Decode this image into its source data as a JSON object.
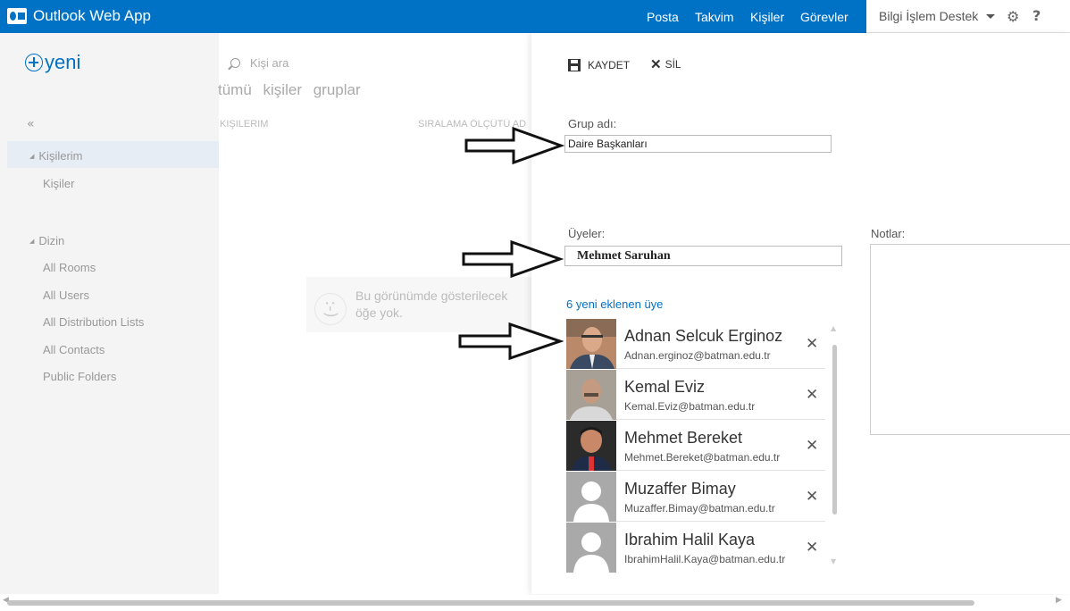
{
  "topbar": {
    "app_title": "Outlook Web App",
    "nav": [
      "Posta",
      "Takvim",
      "Kişiler",
      "Görevler"
    ],
    "user_name": "Bilgi İşlem Destek",
    "settings_icon": "gear-icon",
    "help_label": "?",
    "accent_color": "#0072c6"
  },
  "left": {
    "new_label": "yeni",
    "collapse_label": "«",
    "my_contacts": "Kişilerim",
    "contacts": "Kişiler",
    "directory": "Dizin",
    "directory_items": [
      "All Rooms",
      "All Users",
      "All Distribution Lists",
      "All Contacts",
      "Public Folders"
    ]
  },
  "middle": {
    "search_placeholder": "Kişi ara",
    "filters": [
      "tümü",
      "kişiler",
      "gruplar"
    ],
    "col_left": "KIŞILERIM",
    "col_right": "SIRALAMA ÖLÇÜTÜ AD",
    "empty_face": ":-)",
    "empty_text": "Bu görünümde gösterilecek öğe yok."
  },
  "right": {
    "save_label": "KAYDET",
    "delete_label": "SİL",
    "group_name_label": "Grup adı:",
    "group_name_value": "Daire Başkanları",
    "members_label": "Üyeler:",
    "members_input_value": "Mehmet Saruhan",
    "notes_label": "Notlar:",
    "added_link": "6 yeni eklenen üye",
    "members": [
      {
        "name": "Adnan Selcuk Erginoz",
        "email": "Adnan.erginoz@batman.edu.tr"
      },
      {
        "name": "Kemal Eviz",
        "email": "Kemal.Eviz@batman.edu.tr"
      },
      {
        "name": "Mehmet Bereket",
        "email": "Mehmet.Bereket@batman.edu.tr"
      },
      {
        "name": "Muzaffer Bimay",
        "email": "Muzaffer.Bimay@batman.edu.tr"
      },
      {
        "name": "Ibrahim Halil Kaya",
        "email": "IbrahimHalil.Kaya@batman.edu.tr"
      }
    ],
    "remove_label": "✕"
  }
}
